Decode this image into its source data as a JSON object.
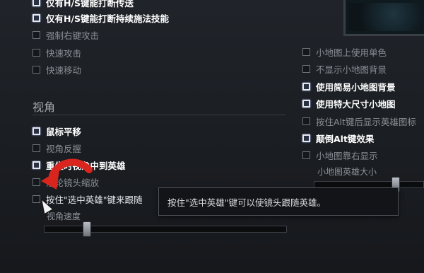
{
  "left_options": [
    {
      "label": "仅有H/S键能打断传送",
      "checked": true
    },
    {
      "label": "仅有H/S键能打断持续施法技能",
      "checked": true
    },
    {
      "label": "强制右键攻击",
      "checked": false
    },
    {
      "label": "快速攻击",
      "checked": false
    },
    {
      "label": "快速移动",
      "checked": false
    }
  ],
  "camera_section": {
    "title": "视角",
    "options": [
      {
        "label": "鼠标平移",
        "checked": true
      },
      {
        "label": "视角反握",
        "checked": false
      },
      {
        "label": "重生时视角中到英雄",
        "checked": true
      },
      {
        "label": "滚轮镜头缩放",
        "checked": false
      },
      {
        "label": "按住\"选中英雄\"键来跟随",
        "checked": false
      }
    ],
    "speed_slider": {
      "label": "视角速度",
      "value": 0.18
    }
  },
  "minimap_options": [
    {
      "label": "小地图上使用单色",
      "checked": false
    },
    {
      "label": "不显示小地图背景",
      "checked": false
    },
    {
      "label": "使用简易小地图背景",
      "checked": true
    },
    {
      "label": "使用特大尺寸小地图",
      "checked": true
    },
    {
      "label": "按住Alt键后显示英雄图标",
      "checked": false
    },
    {
      "label": "颠倒Alt键效果",
      "checked": true
    },
    {
      "label": "小地图靠右显示",
      "checked": false
    }
  ],
  "minimap_hero_size_slider": {
    "label": "小地图英雄大小",
    "value": 0.75
  },
  "tooltip": {
    "text": "按住\"选中英雄\"键可以使镜头跟随英雄。"
  }
}
